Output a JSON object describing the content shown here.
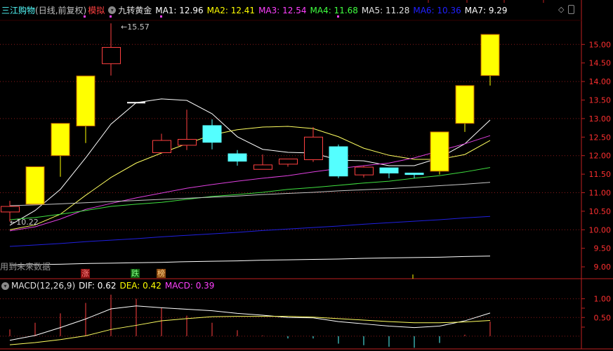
{
  "header": {
    "stock_name": "三江购物",
    "period": "(日线,前复权)",
    "mode": "模拟",
    "indicator": "九转黄金",
    "ma": [
      {
        "label": "MA1: 12.96",
        "color": "#ffffff"
      },
      {
        "label": "MA2: 12.41",
        "color": "#ffff00"
      },
      {
        "label": "MA3: 12.54",
        "color": "#ff40ff"
      },
      {
        "label": "MA4: 11.68",
        "color": "#40ff40"
      },
      {
        "label": "MA5: 11.28",
        "color": "#d0d0d0"
      },
      {
        "label": "MA6: 10.36",
        "color": "#2020ff"
      },
      {
        "label": "MA7: 9.29",
        "color": "#ffffff"
      }
    ]
  },
  "icons": {
    "diamond": "diamond-icon",
    "panel": "panel-toggle-icon",
    "indicator": "chevron-down-icon"
  },
  "annotations": {
    "high": "15.57",
    "low": "10.22",
    "future_warning": "用到未来数据"
  },
  "tags": [
    {
      "text": "涨",
      "bg": "#8b1010",
      "color": "#ff6060"
    },
    {
      "text": "跌",
      "bg": "#106010",
      "color": "#60ff60"
    },
    {
      "text": "榜",
      "bg": "#8b4a10",
      "color": "#ffd080"
    }
  ],
  "macd_header": {
    "name": "MACD(12,26,9)",
    "dif": "DIF: 0.62",
    "dea": "DEA: 0.42",
    "macd": "MACD: 0.39"
  },
  "colors": {
    "up": "#ff4040",
    "down": "#54ffff",
    "limit": "#ffff00",
    "grid": "#8b1a1a",
    "axis": "#c02020",
    "axis_text": "#ff3030"
  },
  "chart_data": [
    {
      "type": "candlestick",
      "y_ticks": [
        "15.00",
        "14.50",
        "14.00",
        "13.50",
        "13.00",
        "12.50",
        "12.00",
        "11.50",
        "11.00",
        "10.50",
        "10.00",
        "9.50",
        "9.00"
      ],
      "ylim": [
        8.8,
        15.8
      ],
      "grid": true,
      "candles": [
        {
          "o": 10.48,
          "h": 10.78,
          "l": 10.22,
          "c": 10.63,
          "style": "up"
        },
        {
          "o": 10.69,
          "h": 11.7,
          "l": 10.69,
          "c": 11.7,
          "style": "limit"
        },
        {
          "o": 12.0,
          "h": 12.87,
          "l": 11.43,
          "c": 12.87,
          "style": "limit"
        },
        {
          "o": 12.8,
          "h": 14.15,
          "l": 12.34,
          "c": 14.15,
          "style": "limit"
        },
        {
          "o": 14.48,
          "h": 15.57,
          "l": 14.16,
          "c": 14.92,
          "style": "up"
        },
        {
          "o": 13.43,
          "h": 13.43,
          "l": 13.43,
          "c": 13.43,
          "style": "doji"
        },
        {
          "o": 12.08,
          "h": 12.59,
          "l": 12.08,
          "c": 12.41,
          "style": "up"
        },
        {
          "o": 12.28,
          "h": 13.24,
          "l": 12.15,
          "c": 12.44,
          "style": "up"
        },
        {
          "o": 12.81,
          "h": 12.98,
          "l": 12.17,
          "c": 12.36,
          "style": "down"
        },
        {
          "o": 12.05,
          "h": 12.15,
          "l": 11.73,
          "c": 11.85,
          "style": "down"
        },
        {
          "o": 11.63,
          "h": 12.03,
          "l": 11.63,
          "c": 11.75,
          "style": "up"
        },
        {
          "o": 11.77,
          "h": 11.91,
          "l": 11.7,
          "c": 11.91,
          "style": "up"
        },
        {
          "o": 11.89,
          "h": 12.77,
          "l": 11.83,
          "c": 12.5,
          "style": "up"
        },
        {
          "o": 12.24,
          "h": 12.3,
          "l": 11.39,
          "c": 11.45,
          "style": "down"
        },
        {
          "o": 11.48,
          "h": 11.73,
          "l": 11.41,
          "c": 11.69,
          "style": "up"
        },
        {
          "o": 11.67,
          "h": 11.67,
          "l": 11.39,
          "c": 11.53,
          "style": "down"
        },
        {
          "o": 11.53,
          "h": 11.53,
          "l": 11.39,
          "c": 11.49,
          "style": "down"
        },
        {
          "o": 11.58,
          "h": 12.64,
          "l": 11.49,
          "c": 12.64,
          "style": "limit"
        },
        {
          "o": 12.87,
          "h": 13.89,
          "l": 12.64,
          "c": 13.89,
          "style": "limit"
        },
        {
          "o": 14.16,
          "h": 15.27,
          "l": 13.89,
          "c": 15.27,
          "style": "limit"
        }
      ],
      "series": [
        {
          "name": "MA1",
          "color": "#ffffff",
          "values": [
            10.12,
            10.52,
            11.09,
            11.94,
            12.85,
            13.43,
            13.53,
            13.49,
            13.13,
            12.51,
            12.17,
            12.09,
            12.07,
            11.88,
            11.86,
            11.73,
            11.73,
            11.94,
            12.32,
            12.96
          ]
        },
        {
          "name": "MA2",
          "color": "#ffff60",
          "values": [
            10.0,
            10.13,
            10.42,
            10.93,
            11.41,
            11.8,
            12.07,
            12.32,
            12.56,
            12.7,
            12.77,
            12.79,
            12.73,
            12.51,
            12.2,
            12.01,
            11.9,
            11.9,
            12.03,
            12.41
          ]
        },
        {
          "name": "MA3",
          "color": "#e040e0",
          "values": [
            9.97,
            10.08,
            10.29,
            10.55,
            10.71,
            10.86,
            10.99,
            11.12,
            11.22,
            11.31,
            11.39,
            11.46,
            11.56,
            11.65,
            11.73,
            11.8,
            11.94,
            12.13,
            12.32,
            12.54
          ]
        },
        {
          "name": "MA4",
          "color": "#40e040",
          "values": [
            10.27,
            10.33,
            10.42,
            10.52,
            10.63,
            10.69,
            10.74,
            10.82,
            10.9,
            10.95,
            11.01,
            11.09,
            11.14,
            11.2,
            11.26,
            11.31,
            11.39,
            11.46,
            11.56,
            11.68
          ]
        },
        {
          "name": "MA5",
          "color": "#c8c8c8",
          "values": [
            10.65,
            10.67,
            10.7,
            10.73,
            10.76,
            10.79,
            10.82,
            10.85,
            10.88,
            10.91,
            10.95,
            10.98,
            11.01,
            11.05,
            11.08,
            11.11,
            11.15,
            11.19,
            11.23,
            11.28
          ]
        },
        {
          "name": "MA6",
          "color": "#2020e0",
          "values": [
            9.55,
            9.59,
            9.63,
            9.68,
            9.72,
            9.76,
            9.81,
            9.85,
            9.89,
            9.93,
            9.98,
            10.02,
            10.06,
            10.1,
            10.15,
            10.19,
            10.23,
            10.27,
            10.32,
            10.36
          ]
        },
        {
          "name": "MA7",
          "color": "#ffffff",
          "values": [
            9.05,
            9.06,
            9.07,
            9.09,
            9.1,
            9.11,
            9.12,
            9.14,
            9.15,
            9.16,
            9.18,
            9.19,
            9.2,
            9.21,
            9.23,
            9.24,
            9.25,
            9.26,
            9.28,
            9.29
          ]
        }
      ]
    },
    {
      "type": "bar+line",
      "y_ticks": [
        "1.00",
        "0.50"
      ],
      "ylim": [
        -0.33,
        1.3
      ],
      "macd": [
        0.18,
        0.36,
        0.61,
        0.89,
        1.11,
        1.0,
        0.76,
        0.55,
        0.36,
        0.16,
        0.02,
        -0.06,
        -0.06,
        -0.2,
        -0.24,
        -0.28,
        -0.31,
        -0.18,
        0.04,
        0.39
      ],
      "series": [
        {
          "name": "DIF",
          "color": "#ffffff",
          "values": [
            -0.11,
            0.02,
            0.23,
            0.46,
            0.73,
            0.81,
            0.76,
            0.72,
            0.68,
            0.61,
            0.56,
            0.5,
            0.49,
            0.39,
            0.33,
            0.27,
            0.23,
            0.27,
            0.41,
            0.62
          ]
        },
        {
          "name": "DEA",
          "color": "#ffff60",
          "values": [
            -0.23,
            -0.17,
            -0.09,
            0.01,
            0.18,
            0.29,
            0.41,
            0.47,
            0.52,
            0.53,
            0.53,
            0.53,
            0.51,
            0.47,
            0.43,
            0.39,
            0.36,
            0.36,
            0.38,
            0.42
          ]
        }
      ]
    }
  ]
}
